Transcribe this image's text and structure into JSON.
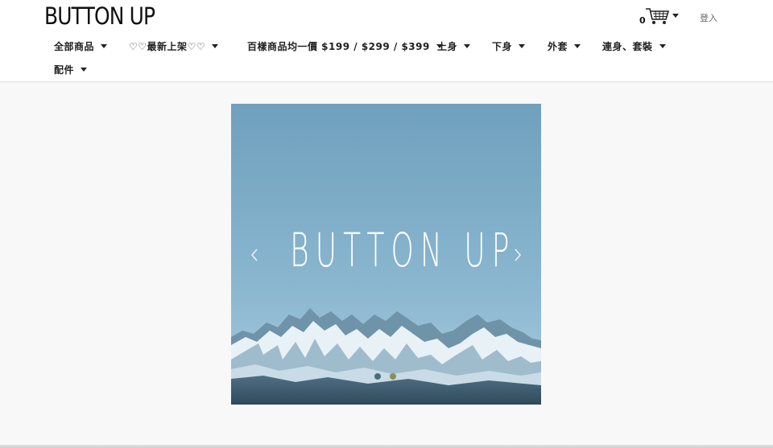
{
  "header": {
    "logo": "BUTTON UP",
    "cart_count": "0",
    "login_label": "登入"
  },
  "nav": {
    "items": [
      {
        "label": "全部商品"
      },
      {
        "label": "♡♡最新上架♡♡"
      },
      {
        "label": "百樣商品均一價 $199 / $299 / $399"
      },
      {
        "label": "上身"
      },
      {
        "label": "下身"
      },
      {
        "label": "外套"
      },
      {
        "label": "連身、套裝"
      },
      {
        "label": "配件"
      }
    ]
  },
  "banner": {
    "title": "BUTTON UP",
    "slide_count": 2,
    "active_slide": 2
  },
  "colors": {
    "sky_top": "#6fa0bd",
    "sky_bottom": "#a9cde0",
    "snow": "#e8f1f6",
    "rock": "#4d6f85",
    "dot_inactive": "#4a6e80",
    "dot_active": "#8a8f5a"
  }
}
